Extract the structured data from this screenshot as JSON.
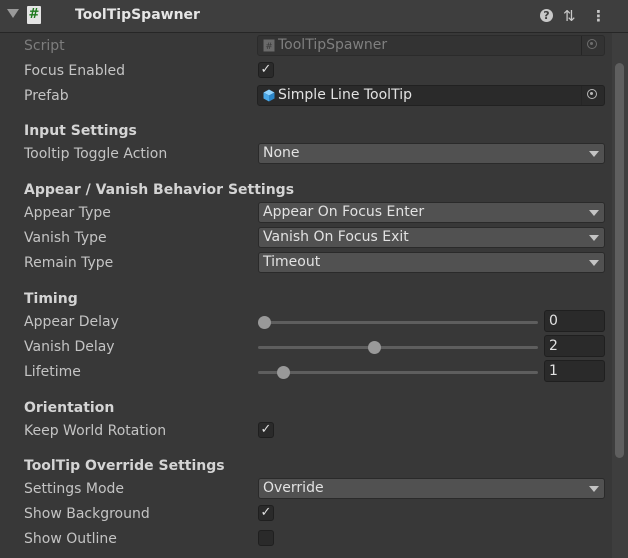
{
  "component": {
    "title": "ToolTipSpawner",
    "script_icon": "#"
  },
  "fields": {
    "script": {
      "label": "Script",
      "value": "ToolTipSpawner"
    },
    "focus_enabled": {
      "label": "Focus Enabled",
      "checked": true,
      "check": "✓"
    },
    "prefab": {
      "label": "Prefab",
      "value": "Simple Line ToolTip"
    }
  },
  "input_settings": {
    "header": "Input Settings",
    "tooltip_toggle_action": {
      "label": "Tooltip Toggle Action",
      "value": "None"
    }
  },
  "appear_vanish": {
    "header": "Appear / Vanish Behavior Settings",
    "appear_type": {
      "label": "Appear Type",
      "value": "Appear On Focus Enter"
    },
    "vanish_type": {
      "label": "Vanish Type",
      "value": "Vanish On Focus Exit"
    },
    "remain_type": {
      "label": "Remain Type",
      "value": "Timeout"
    }
  },
  "timing": {
    "header": "Timing",
    "appear_delay": {
      "label": "Appear Delay",
      "value": "0",
      "fraction": 0.0
    },
    "vanish_delay": {
      "label": "Vanish Delay",
      "value": "2",
      "fraction": 0.4
    },
    "lifetime": {
      "label": "Lifetime",
      "value": "1",
      "fraction": 0.07
    }
  },
  "orientation": {
    "header": "Orientation",
    "keep_world_rotation": {
      "label": "Keep World Rotation",
      "checked": true,
      "check": "✓"
    }
  },
  "override": {
    "header": "ToolTip Override Settings",
    "settings_mode": {
      "label": "Settings Mode",
      "value": "Override"
    },
    "show_background": {
      "label": "Show Background",
      "checked": true,
      "check": "✓"
    },
    "show_outline": {
      "label": "Show Outline",
      "checked": false,
      "check": ""
    }
  },
  "colors": {
    "panel_bg": "#383838",
    "field_bg": "#2a2a2a",
    "dropdown_bg": "#515151",
    "text": "#c4c4c4"
  }
}
